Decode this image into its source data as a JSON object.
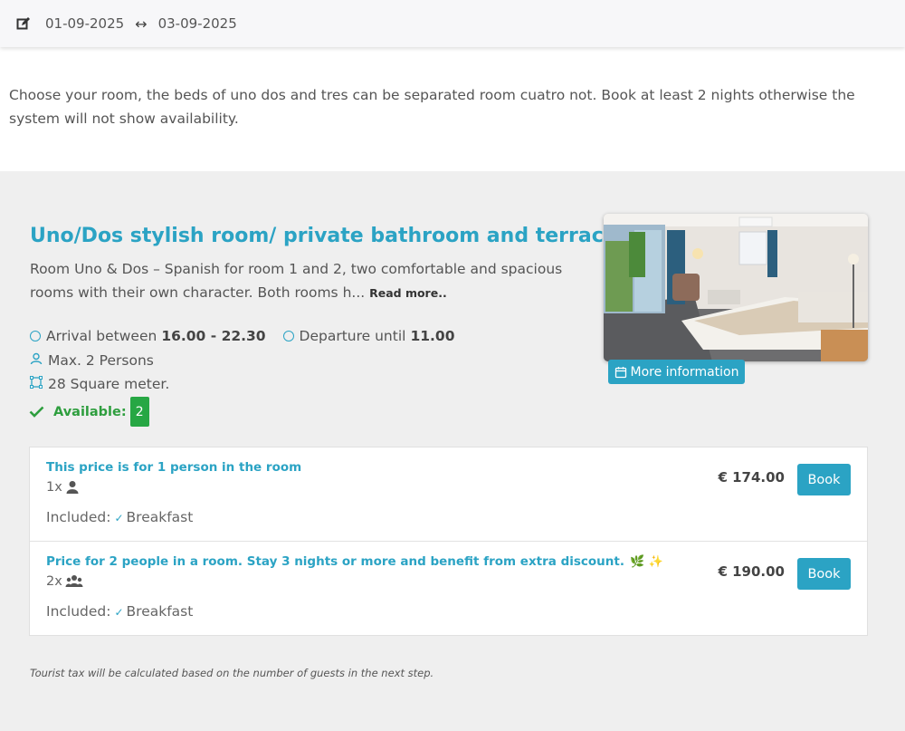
{
  "header": {
    "edit_icon": "edit-icon",
    "date_from": "01-09-2025",
    "arrow": "↔",
    "date_to": "03-09-2025"
  },
  "intro": {
    "text": "Choose your room, the beds of uno dos and tres can be separated room cuatro not. Book at least 2 nights otherwise the system will not show availability."
  },
  "room": {
    "title": "Uno/Dos stylish room/ private bathroom and terrace",
    "description": "Room Uno & Dos – Spanish for room 1 and 2, two comfortable and spacious rooms with their own character. Both rooms h...",
    "read_more": "Read more..",
    "arrival_label": "Arrival between",
    "arrival_time": "16.00 - 22.30",
    "departure_label": "Departure until",
    "departure_time": "11.00",
    "max_persons": "Max. 2 Persons",
    "size": "28 Square meter.",
    "more_info": "More information",
    "available_label": "Available:",
    "available_count": "2"
  },
  "rates": [
    {
      "title": "This price is for 1 person in the room",
      "occupancy": "1x",
      "occupancy_icon": "user-icon",
      "included_label": "Included:",
      "included_item": "Breakfast",
      "price": "€ 174.00",
      "book_label": "Book"
    },
    {
      "title": "Price for 2 people in a room. Stay 3 nights or more and benefit from extra discount.",
      "emoji": "🌿 ✨",
      "occupancy": "2x",
      "occupancy_icon": "users-icon",
      "included_label": "Included:",
      "included_item": "Breakfast",
      "price": "€ 190.00",
      "book_label": "Book"
    }
  ],
  "footer": {
    "tax_note": "Tourist tax will be calculated based on the number of guests in the next step."
  },
  "colors": {
    "accent": "#2ba3c4",
    "success": "#27a744"
  }
}
